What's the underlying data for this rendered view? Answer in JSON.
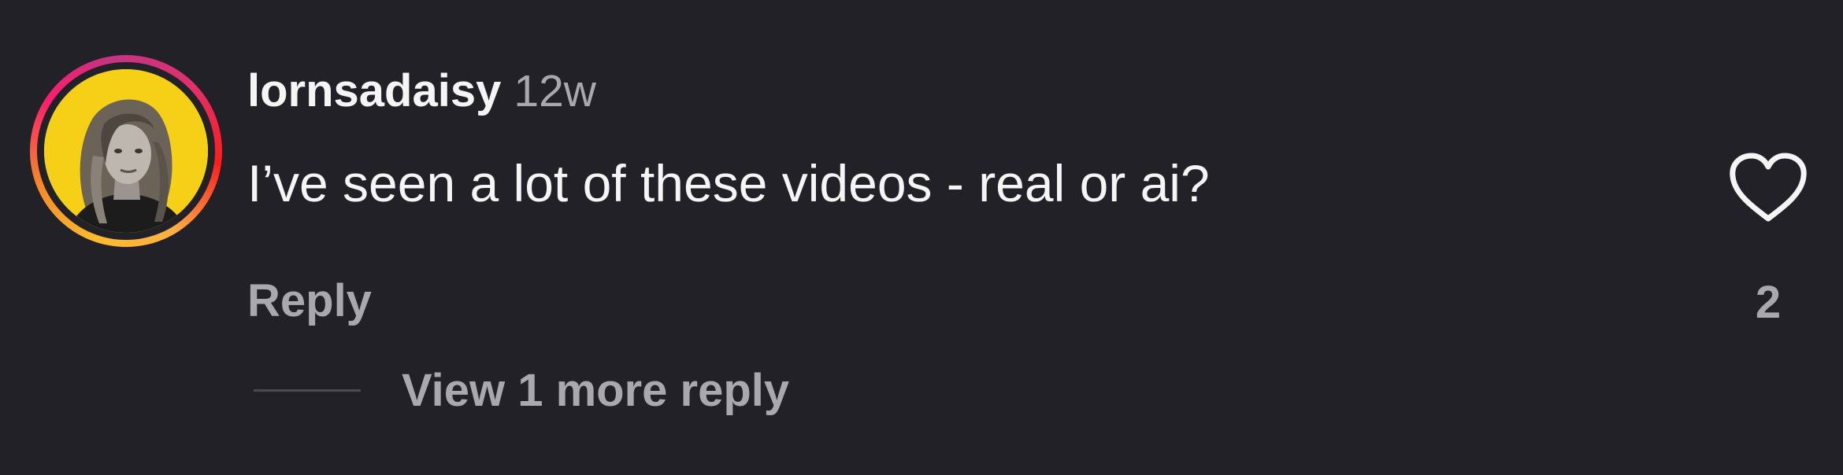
{
  "comment": {
    "username": "lornsadaisy",
    "timestamp": "12w",
    "text": "I’ve seen a lot of these videos - real or ai?",
    "reply_label": "Reply",
    "like_count": "2",
    "view_replies_label": "View 1 more reply",
    "avatar_icon": "user-avatar-icon",
    "like_icon": "heart-outline-icon"
  },
  "colors": {
    "background": "#212127",
    "primary_text": "#f5f5f5",
    "secondary_text": "#a8a8ae",
    "avatar_background": "#f6cf17"
  }
}
